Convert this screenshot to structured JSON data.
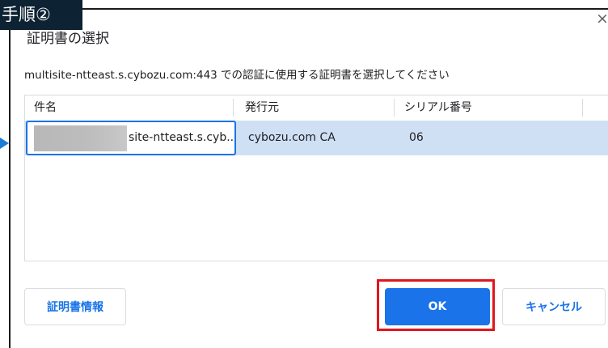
{
  "annotation": {
    "step_label": "手順②",
    "badge_color": "#0d2233",
    "highlight_color": "#e0161d",
    "arrow_color": "#1a7dd6"
  },
  "dialog": {
    "title": "証明書の選択",
    "description": "multisite-ntteast.s.cybozu.com:443 での認証に使用する証明書を選択してください",
    "close_icon": "×",
    "accent_color": "#1a73e8"
  },
  "table": {
    "columns": [
      "件名",
      "発行元",
      "シリアル番号"
    ],
    "rows": [
      {
        "subject": "site-ntteast.s.cyb...",
        "issuer": "cybozu.com CA",
        "serial": "06",
        "selected": true
      }
    ]
  },
  "buttons": {
    "cert_info": "証明書情報",
    "ok": "OK",
    "cancel": "キャンセル"
  }
}
